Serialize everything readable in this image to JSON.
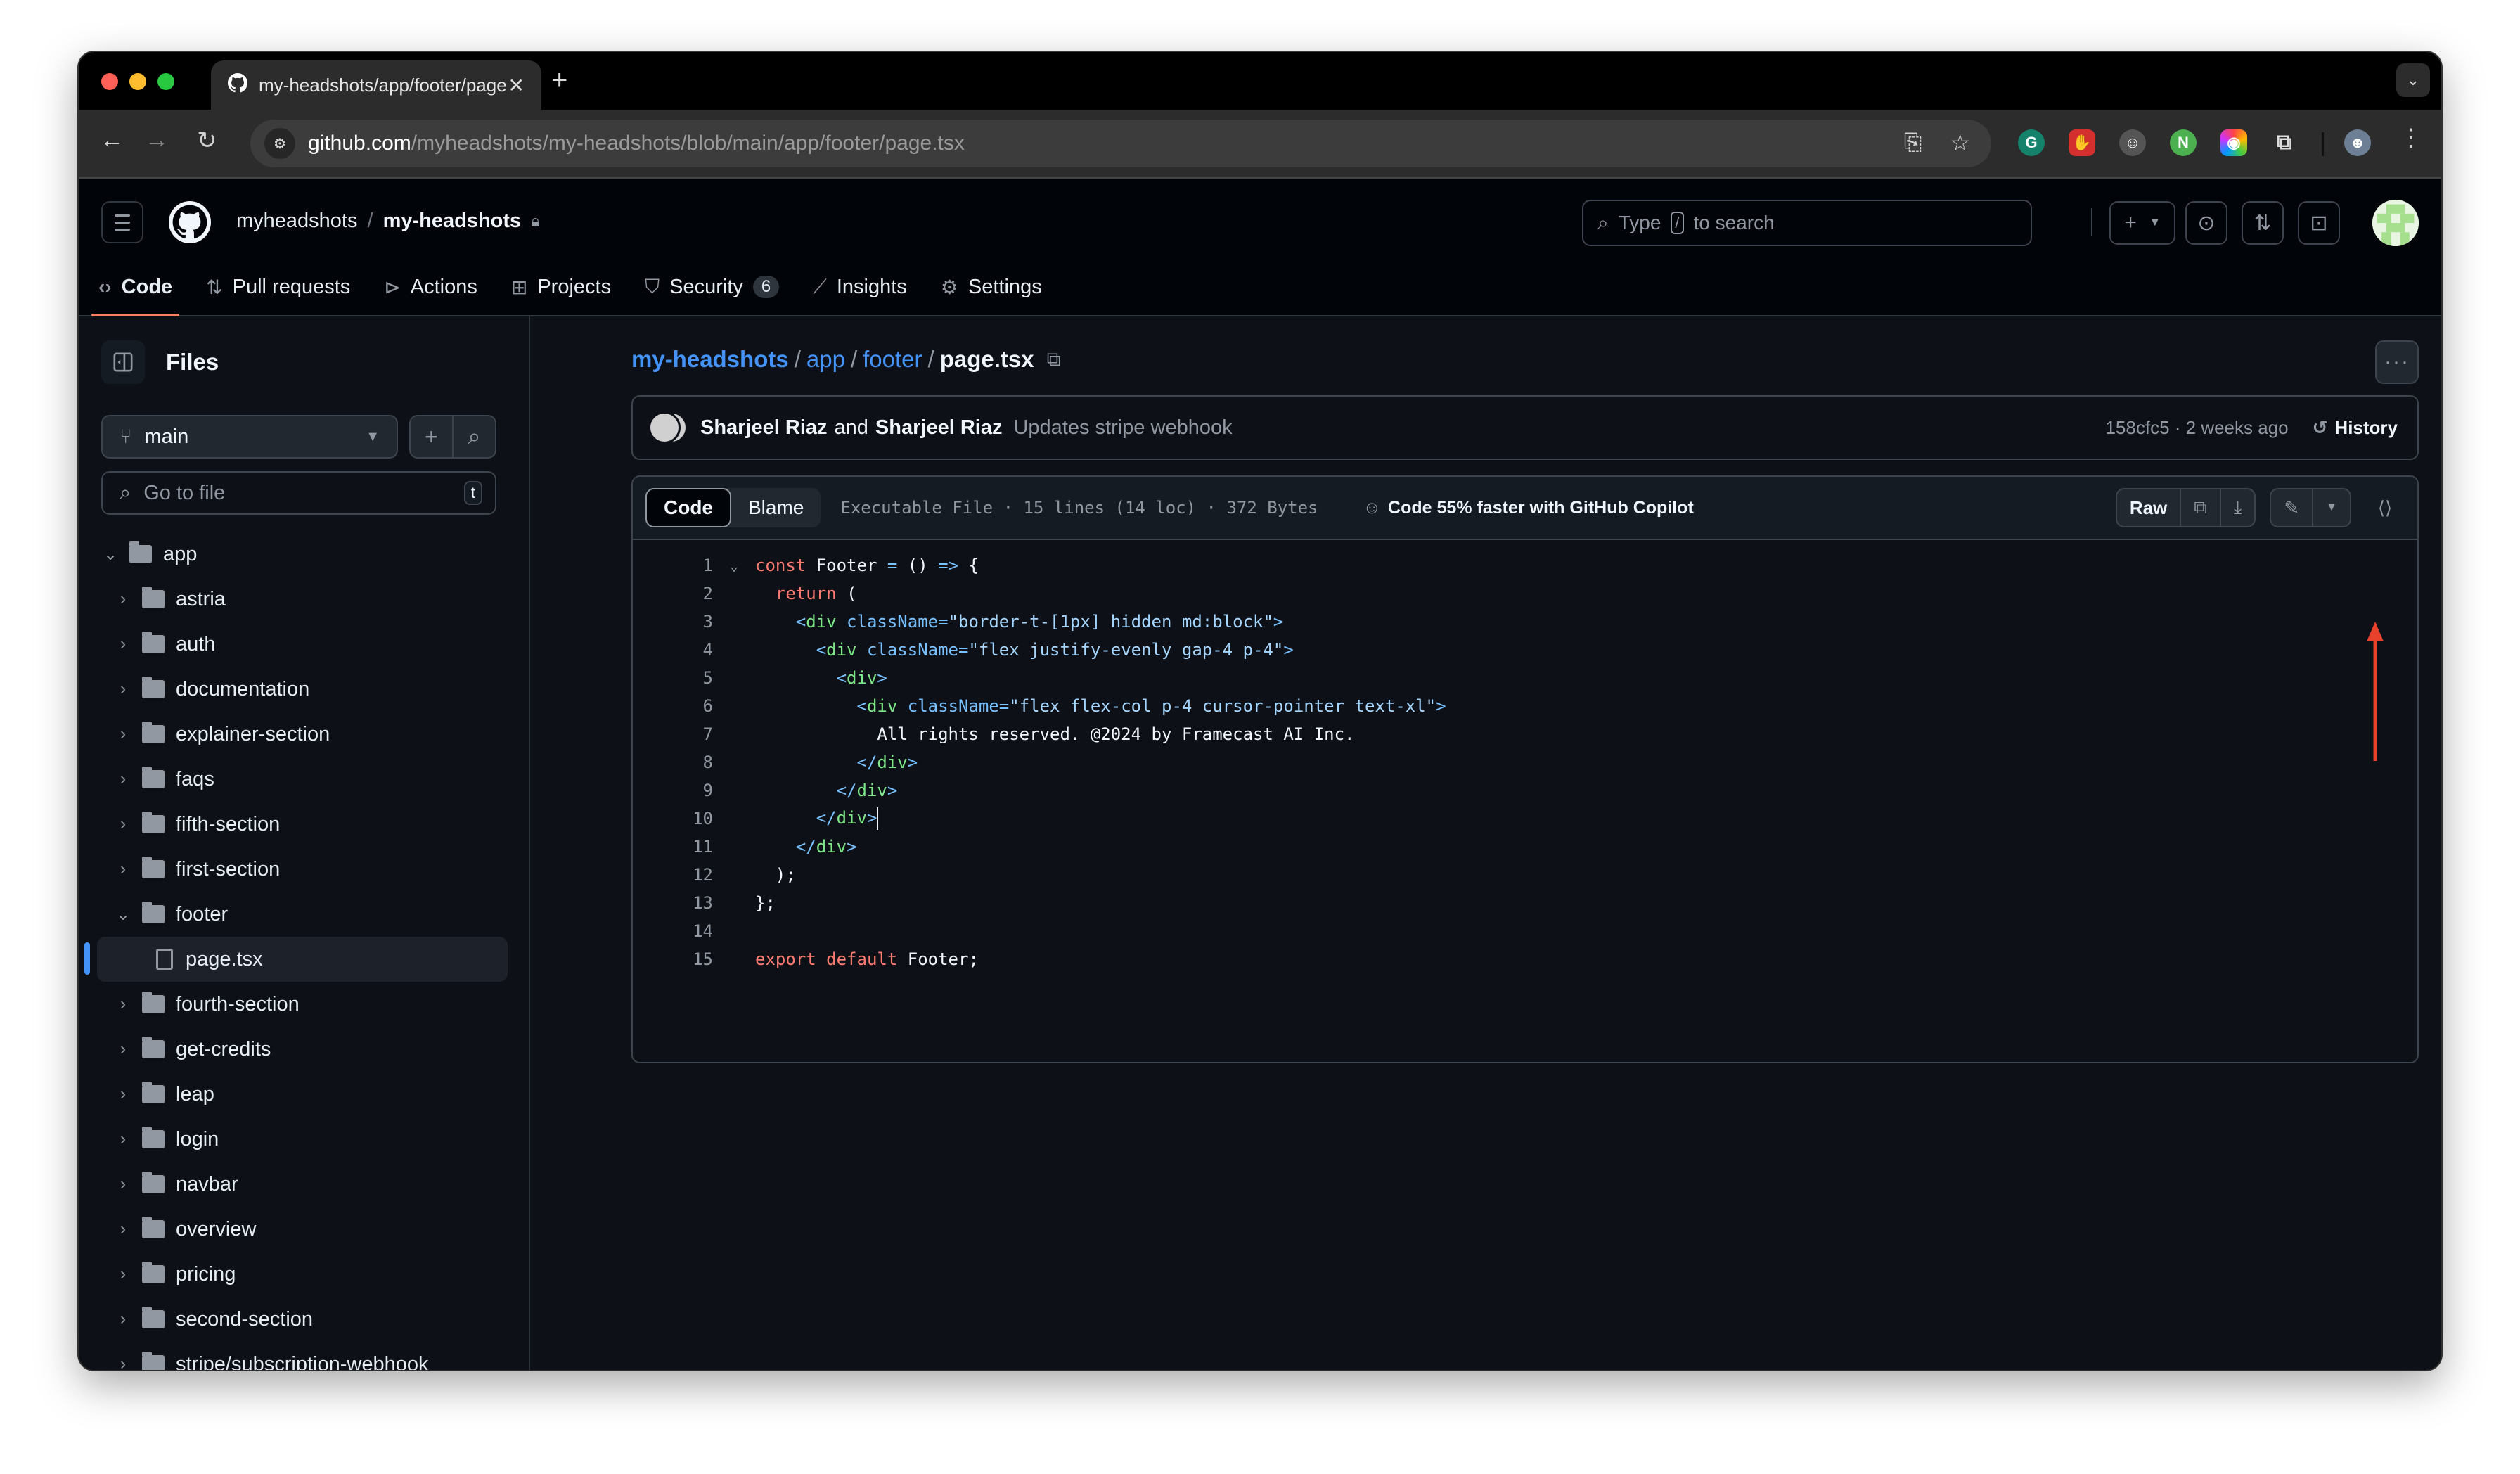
{
  "browser": {
    "tab_title": "my-headshots/app/footer/page.tsx",
    "url_host": "github.com",
    "url_path": "/myheadshots/my-headshots/blob/main/app/footer/page.tsx",
    "extensions": [
      "grammarly",
      "adblock",
      "robot",
      "nimbus",
      "colorpicker",
      "puzzle"
    ]
  },
  "header": {
    "owner": "myheadshots",
    "repo": "my-headshots",
    "search_placeholder_prefix": "Type",
    "search_key": "/",
    "search_placeholder_suffix": "to search"
  },
  "repo_nav": [
    {
      "label": "Code",
      "icon": "code-icon",
      "active": true
    },
    {
      "label": "Pull requests",
      "icon": "pull-request-icon"
    },
    {
      "label": "Actions",
      "icon": "play-icon"
    },
    {
      "label": "Projects",
      "icon": "table-icon"
    },
    {
      "label": "Security",
      "icon": "shield-icon",
      "count": "6"
    },
    {
      "label": "Insights",
      "icon": "graph-icon"
    },
    {
      "label": "Settings",
      "icon": "gear-icon"
    }
  ],
  "sidebar": {
    "title": "Files",
    "branch": "main",
    "goto_placeholder": "Go to file",
    "goto_key": "t",
    "tree": [
      {
        "name": "app",
        "type": "folder",
        "depth": 0,
        "expanded": true
      },
      {
        "name": "astria",
        "type": "folder",
        "depth": 1
      },
      {
        "name": "auth",
        "type": "folder",
        "depth": 1
      },
      {
        "name": "documentation",
        "type": "folder",
        "depth": 1
      },
      {
        "name": "explainer-section",
        "type": "folder",
        "depth": 1
      },
      {
        "name": "faqs",
        "type": "folder",
        "depth": 1
      },
      {
        "name": "fifth-section",
        "type": "folder",
        "depth": 1
      },
      {
        "name": "first-section",
        "type": "folder",
        "depth": 1
      },
      {
        "name": "footer",
        "type": "folder",
        "depth": 1,
        "expanded": true
      },
      {
        "name": "page.tsx",
        "type": "file",
        "depth": 2,
        "selected": true
      },
      {
        "name": "fourth-section",
        "type": "folder",
        "depth": 1
      },
      {
        "name": "get-credits",
        "type": "folder",
        "depth": 1
      },
      {
        "name": "leap",
        "type": "folder",
        "depth": 1
      },
      {
        "name": "login",
        "type": "folder",
        "depth": 1
      },
      {
        "name": "navbar",
        "type": "folder",
        "depth": 1
      },
      {
        "name": "overview",
        "type": "folder",
        "depth": 1
      },
      {
        "name": "pricing",
        "type": "folder",
        "depth": 1
      },
      {
        "name": "second-section",
        "type": "folder",
        "depth": 1
      },
      {
        "name": "stripe/subscription-webhook",
        "type": "folder",
        "depth": 1
      }
    ]
  },
  "breadcrumb": {
    "repo": "my-headshots",
    "parts": [
      "app",
      "footer"
    ],
    "current": "page.tsx"
  },
  "commit": {
    "author1": "Sharjeel Riaz",
    "and": "and",
    "author2": "Sharjeel Riaz",
    "message": "Updates stripe webhook",
    "meta": "158cfc5 · 2 weeks ago",
    "history_label": "History"
  },
  "file": {
    "tab_code": "Code",
    "tab_blame": "Blame",
    "info": "Executable File · 15 lines (14 loc) · 372 Bytes",
    "copilot": "Code 55% faster with GitHub Copilot",
    "raw_label": "Raw",
    "lines": [
      [
        [
          "kw",
          "const "
        ],
        [
          "src",
          "Footer "
        ],
        [
          "op",
          "= "
        ],
        [
          "src",
          "() "
        ],
        [
          "op",
          "=> "
        ],
        [
          "src",
          "{"
        ]
      ],
      [
        [
          "src",
          "  "
        ],
        [
          "kw",
          "return "
        ],
        [
          "src",
          "("
        ]
      ],
      [
        [
          "src",
          "    "
        ],
        [
          "op",
          "<"
        ],
        [
          "tag",
          "div "
        ],
        [
          "attr",
          "className"
        ],
        [
          "op",
          "="
        ],
        [
          "str",
          "\"border-t-[1px] hidden md:block\""
        ],
        [
          "op",
          ">"
        ]
      ],
      [
        [
          "src",
          "      "
        ],
        [
          "op",
          "<"
        ],
        [
          "tag",
          "div "
        ],
        [
          "attr",
          "className"
        ],
        [
          "op",
          "="
        ],
        [
          "str",
          "\"flex justify-evenly gap-4 p-4\""
        ],
        [
          "op",
          ">"
        ]
      ],
      [
        [
          "src",
          "        "
        ],
        [
          "op",
          "<"
        ],
        [
          "tag",
          "div"
        ],
        [
          "op",
          ">"
        ]
      ],
      [
        [
          "src",
          "          "
        ],
        [
          "op",
          "<"
        ],
        [
          "tag",
          "div "
        ],
        [
          "attr",
          "className"
        ],
        [
          "op",
          "="
        ],
        [
          "str",
          "\"flex flex-col p-4 cursor-pointer text-xl\""
        ],
        [
          "op",
          ">"
        ]
      ],
      [
        [
          "src",
          "            All rights reserved. @2024 by Framecast AI Inc."
        ]
      ],
      [
        [
          "src",
          "          "
        ],
        [
          "op",
          "</"
        ],
        [
          "tag",
          "div"
        ],
        [
          "op",
          ">"
        ]
      ],
      [
        [
          "src",
          "        "
        ],
        [
          "op",
          "</"
        ],
        [
          "tag",
          "div"
        ],
        [
          "op",
          ">"
        ]
      ],
      [
        [
          "src",
          "      "
        ],
        [
          "op",
          "</"
        ],
        [
          "tag",
          "div"
        ],
        [
          "op",
          ">"
        ]
      ],
      [
        [
          "src",
          "    "
        ],
        [
          "op",
          "</"
        ],
        [
          "tag",
          "div"
        ],
        [
          "op",
          ">"
        ]
      ],
      [
        [
          "src",
          "  );"
        ]
      ],
      [
        [
          "src",
          "};"
        ]
      ],
      [],
      [
        [
          "kw",
          "export "
        ],
        [
          "kw",
          "default "
        ],
        [
          "src",
          "Footer;"
        ]
      ]
    ],
    "cursor_line": 10
  },
  "annotation": {
    "type": "arrow",
    "color": "#e8412c",
    "points_to": "edit-file-button"
  }
}
